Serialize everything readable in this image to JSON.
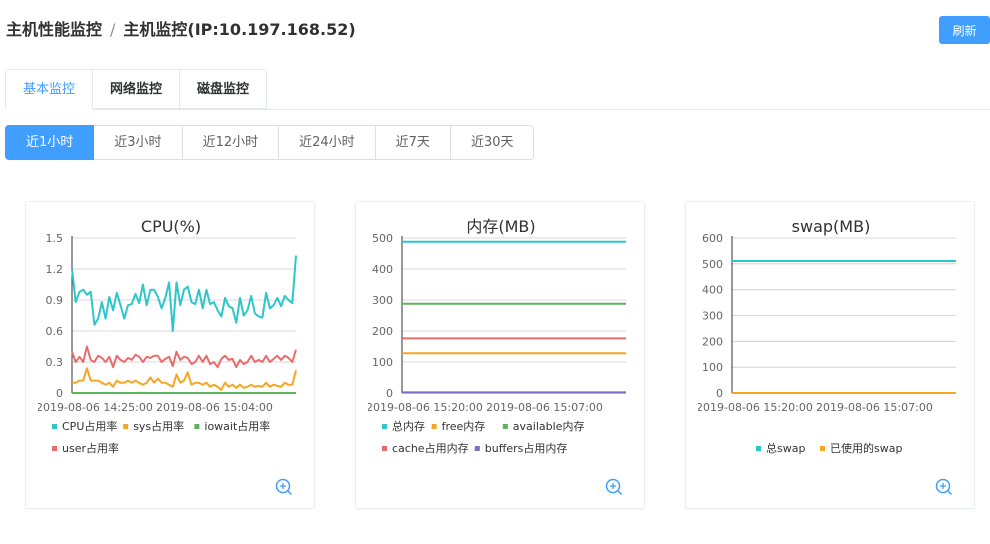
{
  "header": {
    "title": "主机性能监控",
    "separator": "/",
    "subtitle": "主机监控(IP:10.197.168.52)",
    "refresh_label": "刷新"
  },
  "tabs": [
    {
      "label": "基本监控",
      "active": true
    },
    {
      "label": "网络监控",
      "active": false
    },
    {
      "label": "磁盘监控",
      "active": false
    }
  ],
  "ranges": [
    {
      "label": "近1小时",
      "active": true
    },
    {
      "label": "近3小时",
      "active": false
    },
    {
      "label": "近12小时",
      "active": false
    },
    {
      "label": "近24小时",
      "active": false
    },
    {
      "label": "近7天",
      "active": false
    },
    {
      "label": "近30天",
      "active": false
    }
  ],
  "colors": {
    "accent": "#409eff"
  },
  "icons": {
    "zoom": "zoom-in-icon"
  },
  "chart_data": [
    {
      "type": "line",
      "title": "CPU(%)",
      "ylim": [
        0,
        1.5
      ],
      "yticks": [
        "0",
        "0.3",
        "0.6",
        "0.9",
        "1.2",
        "1.5"
      ],
      "xticks": [
        "2019-08-06 14:25:00",
        "2019-08-06 15:04:00"
      ],
      "grid": true,
      "legend_placement": "bottom",
      "series": [
        {
          "name": "CPU占用率",
          "color": "#2ec7c9",
          "values": [
            1.2,
            0.88,
            0.98,
            1.0,
            0.95,
            0.98,
            0.66,
            0.72,
            0.88,
            0.72,
            0.93,
            0.8,
            0.97,
            0.85,
            0.72,
            0.85,
            0.86,
            0.96,
            0.87,
            1.05,
            0.85,
            1.0,
            1.0,
            0.93,
            0.82,
            0.92,
            1.07,
            0.6,
            1.07,
            0.85,
            1.0,
            1.03,
            0.88,
            0.86,
            1.0,
            0.82,
            1.0,
            0.86,
            0.88,
            0.8,
            0.74,
            0.92,
            0.84,
            0.82,
            0.68,
            0.92,
            0.75,
            0.8,
            0.94,
            0.77,
            0.74,
            0.73,
            0.97,
            0.82,
            0.85,
            0.92,
            0.84,
            0.94,
            0.9,
            0.87,
            1.33
          ]
        },
        {
          "name": "sys占用率",
          "color": "#f5a623",
          "values": [
            0.1,
            0.1,
            0.12,
            0.12,
            0.24,
            0.12,
            0.12,
            0.12,
            0.1,
            0.08,
            0.1,
            0.06,
            0.12,
            0.1,
            0.1,
            0.12,
            0.1,
            0.12,
            0.1,
            0.08,
            0.1,
            0.15,
            0.1,
            0.14,
            0.1,
            0.1,
            0.08,
            0.06,
            0.18,
            0.1,
            0.12,
            0.2,
            0.08,
            0.1,
            0.1,
            0.08,
            0.1,
            0.06,
            0.08,
            0.06,
            0.03,
            0.1,
            0.06,
            0.08,
            0.05,
            0.08,
            0.05,
            0.06,
            0.08,
            0.06,
            0.07,
            0.06,
            0.1,
            0.06,
            0.08,
            0.07,
            0.06,
            0.1,
            0.08,
            0.08,
            0.22
          ]
        },
        {
          "name": "iowait占用率",
          "color": "#5ab65a",
          "values": [
            0,
            0,
            0,
            0,
            0,
            0,
            0,
            0,
            0,
            0,
            0,
            0,
            0,
            0,
            0,
            0,
            0,
            0,
            0,
            0,
            0,
            0,
            0,
            0,
            0,
            0,
            0,
            0,
            0,
            0,
            0,
            0,
            0,
            0,
            0,
            0,
            0,
            0,
            0,
            0,
            0,
            0,
            0,
            0,
            0,
            0,
            0,
            0,
            0,
            0,
            0,
            0,
            0,
            0,
            0,
            0,
            0,
            0,
            0,
            0,
            0
          ]
        },
        {
          "name": "user占用率",
          "color": "#e86c6c",
          "values": [
            0.4,
            0.3,
            0.35,
            0.3,
            0.45,
            0.32,
            0.3,
            0.36,
            0.34,
            0.3,
            0.35,
            0.25,
            0.36,
            0.32,
            0.3,
            0.34,
            0.32,
            0.37,
            0.35,
            0.3,
            0.35,
            0.34,
            0.36,
            0.36,
            0.3,
            0.33,
            0.35,
            0.26,
            0.4,
            0.32,
            0.35,
            0.34,
            0.28,
            0.3,
            0.36,
            0.3,
            0.36,
            0.28,
            0.3,
            0.25,
            0.33,
            0.36,
            0.32,
            0.33,
            0.25,
            0.32,
            0.28,
            0.3,
            0.36,
            0.3,
            0.32,
            0.3,
            0.36,
            0.3,
            0.33,
            0.36,
            0.32,
            0.36,
            0.34,
            0.3,
            0.42
          ]
        }
      ]
    },
    {
      "type": "line",
      "title": "内存(MB)",
      "ylim": [
        0,
        500
      ],
      "yticks": [
        "0",
        "100",
        "200",
        "300",
        "400",
        "500"
      ],
      "xticks": [
        "2019-08-06 15:20:00",
        "2019-08-06 15:07:00"
      ],
      "grid": true,
      "legend_placement": "bottom",
      "series": [
        {
          "name": "总内存",
          "color": "#2ec7c9",
          "values": [
            488,
            488
          ]
        },
        {
          "name": "free内存",
          "color": "#f5a623",
          "values": [
            128,
            128
          ]
        },
        {
          "name": "available内存",
          "color": "#5ab65a",
          "values": [
            288,
            288
          ]
        },
        {
          "name": "cache占用内存",
          "color": "#e86c6c",
          "values": [
            176,
            176
          ]
        },
        {
          "name": "buffers占用内存",
          "color": "#7b6cc9",
          "values": [
            2,
            2
          ]
        }
      ]
    },
    {
      "type": "line",
      "title": "swap(MB)",
      "ylim": [
        0,
        600
      ],
      "yticks": [
        "0",
        "100",
        "200",
        "300",
        "400",
        "500",
        "600"
      ],
      "xticks": [
        "2019-08-06 15:20:00",
        "2019-08-06 15:07:00"
      ],
      "grid": true,
      "legend_placement": "bottom",
      "series": [
        {
          "name": "总swap",
          "color": "#2ec7c9",
          "values": [
            511,
            511
          ]
        },
        {
          "name": "已使用的swap",
          "color": "#f5a623",
          "values": [
            0,
            0
          ]
        }
      ]
    }
  ]
}
